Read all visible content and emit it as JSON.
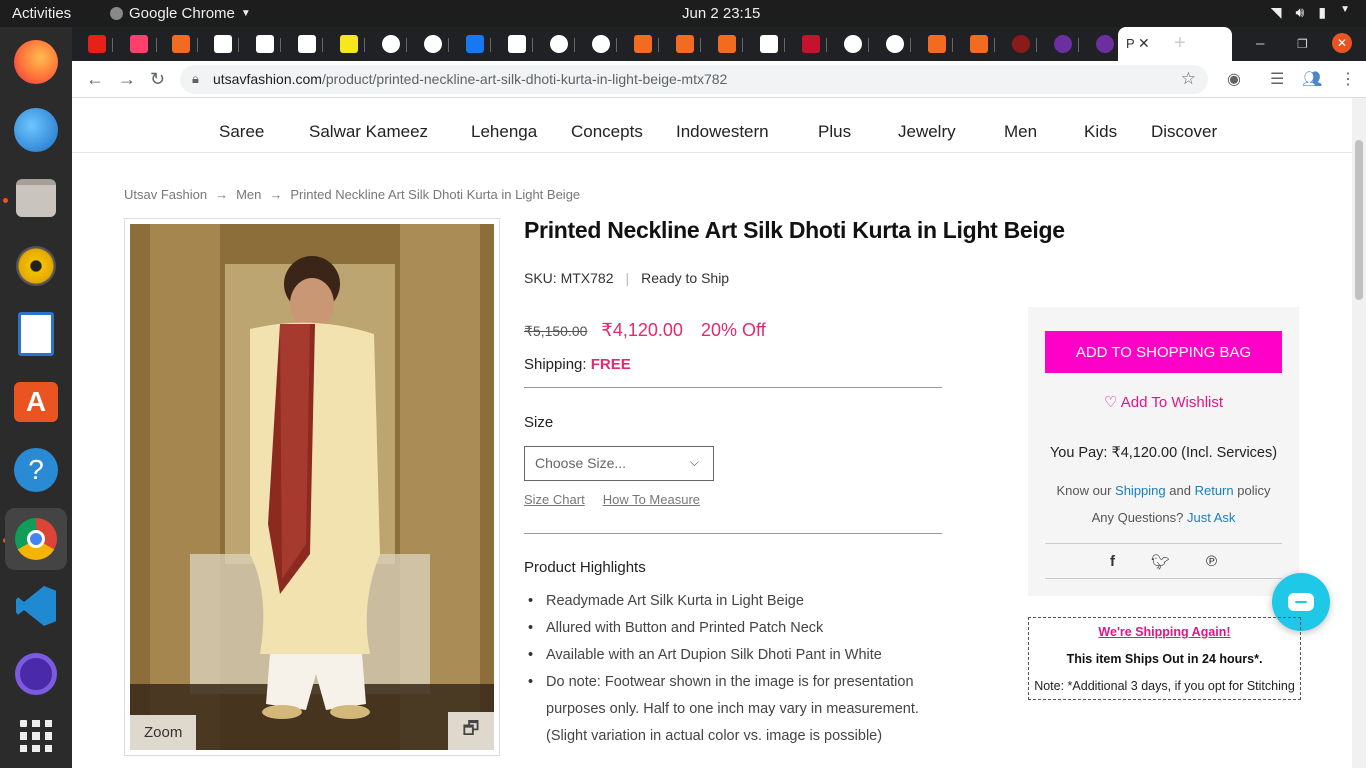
{
  "os": {
    "activities": "Activities",
    "app_name": "Google Chrome",
    "clock": "Jun 2  23:15"
  },
  "browser": {
    "active_tab_title": "P",
    "url_domain": "utsavfashion.com",
    "url_path": "/product/printed-neckline-art-silk-dhoti-kurta-in-light-beige-mtx782"
  },
  "nav": {
    "items": [
      "Saree",
      "Salwar Kameez",
      "Lehenga",
      "Concepts",
      "Indowestern",
      "Plus",
      "Jewelry",
      "Men",
      "Kids",
      "Discover"
    ]
  },
  "breadcrumb": {
    "items": [
      "Utsav Fashion",
      "Men",
      "Printed Neckline Art Silk Dhoti Kurta in Light Beige"
    ],
    "separator": "→"
  },
  "product": {
    "title": "Printed Neckline Art Silk Dhoti Kurta in Light Beige",
    "sku_label": "SKU:",
    "sku": "MTX782",
    "availability": "Ready to Ship",
    "old_price": "₹5,150.00",
    "price": "₹4,120.00",
    "discount": "20% Off",
    "shipping_label": "Shipping:",
    "shipping_value": "FREE",
    "size_label": "Size",
    "size_placeholder": "Choose Size...",
    "size_chart": "Size Chart",
    "how_to_measure": "How To Measure",
    "highlights_title": "Product Highlights",
    "highlights": [
      "Readymade Art Silk Kurta in Light Beige",
      "Allured with Button and Printed Patch Neck",
      "Available with an Art Dupion Silk Dhoti Pant in White",
      "Do note: Footwear shown in the image is for presentation purposes only. Half to one inch may vary in measurement. (Slight variation in actual color vs. image is possible)"
    ],
    "zoom_label": "Zoom"
  },
  "buybox": {
    "add_to_bag": "ADD TO SHOPPING BAG",
    "wishlist": "Add To Wishlist",
    "you_pay_label": "You Pay:",
    "you_pay_value": "₹4,120.00 (Incl. Services)",
    "know_our": "Know our",
    "shipping_link": "Shipping",
    "and": "and",
    "return_link": "Return",
    "policy": "policy",
    "any_questions": "Any Questions?",
    "just_ask": "Just Ask"
  },
  "shipnote": {
    "line1": "We're Shipping Again!",
    "line2": "This item Ships Out in 24 hours*.",
    "line3": "Note: *Additional 3 days, if you opt for Stitching"
  },
  "colors": {
    "accent_pink": "#ff00c8",
    "price_red": "#e22a6c",
    "link_blue": "#1a7fc1",
    "chat_cyan": "#1ec8e6"
  }
}
